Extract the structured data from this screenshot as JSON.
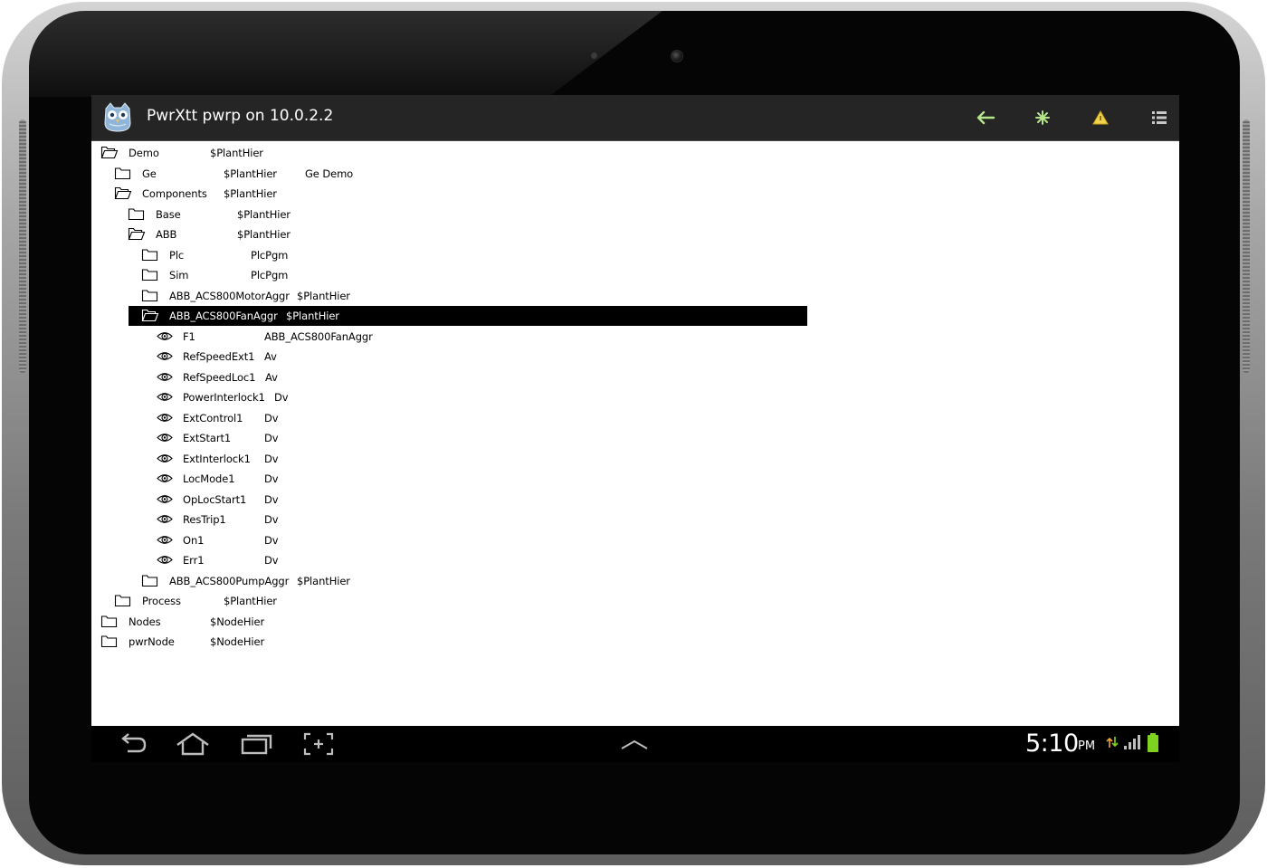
{
  "app": {
    "title": "PwrXtt pwrp on 10.0.2.2"
  },
  "actionbar": {
    "buttons": [
      {
        "name": "back-arrow",
        "icon": "arrow-left-icon",
        "color": "#b6e68a"
      },
      {
        "name": "object-info",
        "icon": "star-icon",
        "color": "#b6e68a"
      },
      {
        "name": "alarm-list",
        "icon": "warning-triangle-icon",
        "color": "#f2d24a"
      },
      {
        "name": "menu",
        "icon": "list-menu-icon",
        "color": "#c8c8c8"
      }
    ]
  },
  "tree": {
    "selected_index": 8,
    "items": [
      {
        "name": "Demo",
        "class": "$PlantHier",
        "desc": "",
        "icon": "folder-open-icon"
      },
      {
        "name": "Ge",
        "class": "$PlantHier",
        "desc": "Ge Demo",
        "icon": "folder-icon"
      },
      {
        "name": "Components",
        "class": "$PlantHier",
        "desc": "",
        "icon": "folder-open-icon"
      },
      {
        "name": "Base",
        "class": "$PlantHier",
        "desc": "",
        "icon": "folder-icon"
      },
      {
        "name": "ABB",
        "class": "$PlantHier",
        "desc": "",
        "icon": "folder-open-icon"
      },
      {
        "name": "Plc",
        "class": "PlcPgm",
        "desc": "",
        "icon": "folder-icon"
      },
      {
        "name": "Sim",
        "class": "PlcPgm",
        "desc": "",
        "icon": "folder-icon"
      },
      {
        "name": "ABB_ACS800MotorAggr",
        "class": "$PlantHier",
        "desc": "",
        "icon": "folder-icon"
      },
      {
        "name": "ABB_ACS800FanAggr",
        "class": "$PlantHier",
        "desc": "",
        "icon": "folder-open-icon"
      },
      {
        "name": "F1",
        "class": "ABB_ACS800FanAggr",
        "desc": "",
        "icon": "eye-icon"
      },
      {
        "name": "RefSpeedExt1",
        "class": "Av",
        "desc": "",
        "icon": "eye-icon"
      },
      {
        "name": "RefSpeedLoc1",
        "class": "Av",
        "desc": "",
        "icon": "eye-icon"
      },
      {
        "name": "PowerInterlock1",
        "class": "Dv",
        "desc": "",
        "icon": "eye-icon"
      },
      {
        "name": "ExtControl1",
        "class": "Dv",
        "desc": "",
        "icon": "eye-icon"
      },
      {
        "name": "ExtStart1",
        "class": "Dv",
        "desc": "",
        "icon": "eye-icon"
      },
      {
        "name": "ExtInterlock1",
        "class": "Dv",
        "desc": "",
        "icon": "eye-icon"
      },
      {
        "name": "LocMode1",
        "class": "Dv",
        "desc": "",
        "icon": "eye-icon"
      },
      {
        "name": "OpLocStart1",
        "class": "Dv",
        "desc": "",
        "icon": "eye-icon"
      },
      {
        "name": "ResTrip1",
        "class": "Dv",
        "desc": "",
        "icon": "eye-icon"
      },
      {
        "name": "On1",
        "class": "Dv",
        "desc": "",
        "icon": "eye-icon"
      },
      {
        "name": "Err1",
        "class": "Dv",
        "desc": "",
        "icon": "eye-icon"
      },
      {
        "name": "ABB_ACS800PumpAggr",
        "class": "$PlantHier",
        "desc": "",
        "icon": "folder-icon"
      },
      {
        "name": "Process",
        "class": "$PlantHier",
        "desc": "",
        "icon": "folder-icon"
      },
      {
        "name": "Nodes",
        "class": "$NodeHier",
        "desc": "",
        "icon": "folder-icon"
      },
      {
        "name": "pwrNode",
        "class": "$NodeHier",
        "desc": "",
        "icon": "folder-icon"
      }
    ]
  },
  "navbar": {
    "buttons": [
      "back-nav-icon",
      "home-icon",
      "recent-apps-icon",
      "screenshot-icon",
      "chevron-up-icon"
    ]
  },
  "status": {
    "time": "5:10",
    "ampm": "PM",
    "battery_color": "#7ed321"
  }
}
